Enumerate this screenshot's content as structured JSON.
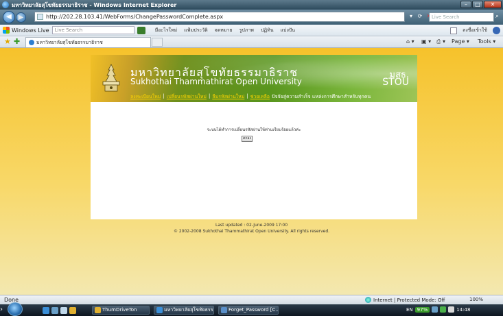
{
  "window": {
    "title": "มหาวิทยาลัยสุโขทัยธรรมาธิราช - Windows Internet Explorer",
    "controls": {
      "minimize": "–",
      "maximize": "□",
      "close": "✕"
    }
  },
  "address_bar": {
    "url": "http://202.28.103.41/WebForms/ChangePasswordComplete.aspx",
    "search_placeholder": "Live Search",
    "back_glyph": "◀",
    "forward_glyph": "▶"
  },
  "live_toolbar": {
    "name": "Windows Live",
    "search_placeholder": "Live Search",
    "items": [
      "มีอะไรใหม่",
      "แฟ้มประวัติ",
      "จดหมาย",
      "รูปภาพ",
      "ปฏิทิน",
      "แบ่งปัน"
    ],
    "right_label": "ลงชื่อเข้าใช้"
  },
  "tab_bar": {
    "tab_label": "มหาวิทยาลัยสุโขทัยธรรมาธิราช",
    "commands": {
      "page": "Page ▾",
      "tools": "Tools ▾"
    }
  },
  "banner": {
    "thai_name": "มหาวิทยาลัยสุโขทัยธรรมาธิราช",
    "english_name": "Sukhothai Thammathirat Open University",
    "abbr_thai": "มสธ.",
    "abbr_english": "STOU",
    "links": [
      "ลงทะเบียนใหม่",
      "เปลี่ยนรหัสผ่านใหม่",
      "ลืมรหัสผ่านใหม่",
      "ช่วยเหลือ"
    ],
    "marquee": "ปัจจัยสู่ความสำเร็จ แหล่งการศึกษาสำหรับทุกคน"
  },
  "content": {
    "message": "ระบบได้ทำการเปลี่ยนรหัสผ่านให้ท่านเรียบร้อยแล้วค่ะ",
    "ok_button": "ตกลง"
  },
  "footer": {
    "updated": "Last updated : 02-June-2009 17:00",
    "copyright": "© 2002-2008 Sukhothai Thammathirat Open University. All rights reserved."
  },
  "status_bar": {
    "status": "Done",
    "zone": "Internet | Protected Mode: Off",
    "zoom": "100%"
  },
  "taskbar": {
    "tasks": [
      "ThumDriveTon",
      "มหาวิทยาลัยสุโขทัยธรร...",
      "Forget_Password [C..."
    ],
    "tray": {
      "language": "EN",
      "battery": "97%",
      "clock": "14:48"
    }
  },
  "colors": {
    "page_background": "#f6c22b",
    "banner_green": "#58951d",
    "link_yellow": "#ffd400"
  }
}
